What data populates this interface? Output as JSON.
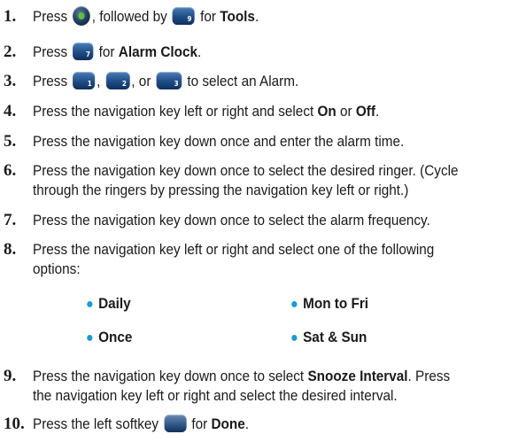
{
  "steps": [
    {
      "num": "1.",
      "p1": "Press",
      "p2": ", followed by",
      "p3": "for",
      "b1": "Tools",
      "p4": "."
    },
    {
      "num": "2.",
      "p1": "Press",
      "p2": "for",
      "b1": "Alarm Clock",
      "p3": "."
    },
    {
      "num": "3.",
      "p1": "Press",
      "p2": ",",
      "p3": ", or",
      "p4": "to select an Alarm."
    },
    {
      "num": "4.",
      "p1": "Press the navigation key left or right and select",
      "b1": "On",
      "p2": "or",
      "b2": "Off",
      "p3": "."
    },
    {
      "num": "5.",
      "p1": "Press the navigation key down once and enter the alarm time."
    },
    {
      "num": "6.",
      "p1": "Press the navigation key down once to select the desired ringer. (Cycle",
      "p2": "through the ringers by pressing the navigation key left or right.)"
    },
    {
      "num": "7.",
      "p1": "Press the navigation key down once to select the alarm frequency."
    },
    {
      "num": "8.",
      "p1": "Press the navigation key left or right and select one of the following",
      "p2": "options:"
    },
    {
      "num": "9.",
      "p1": "Press the navigation key down once to select",
      "b1": "Snooze Interval",
      "p2": ". Press",
      "p3": "the navigation key left or right and select the desired interval."
    },
    {
      "num": "10.",
      "p1": "Press the left softkey",
      "p2": "for",
      "b1": "Done",
      "p3": "."
    }
  ],
  "options": [
    "Daily",
    "Mon to Fri",
    "Once",
    "Sat & Sun"
  ],
  "bullet_color": "#1a9bd7",
  "icons": [
    "menu-ok-key-icon",
    "key-9-icon",
    "key-7-icon",
    "key-1-icon",
    "key-2-icon",
    "key-3-icon",
    "left-softkey-icon"
  ]
}
